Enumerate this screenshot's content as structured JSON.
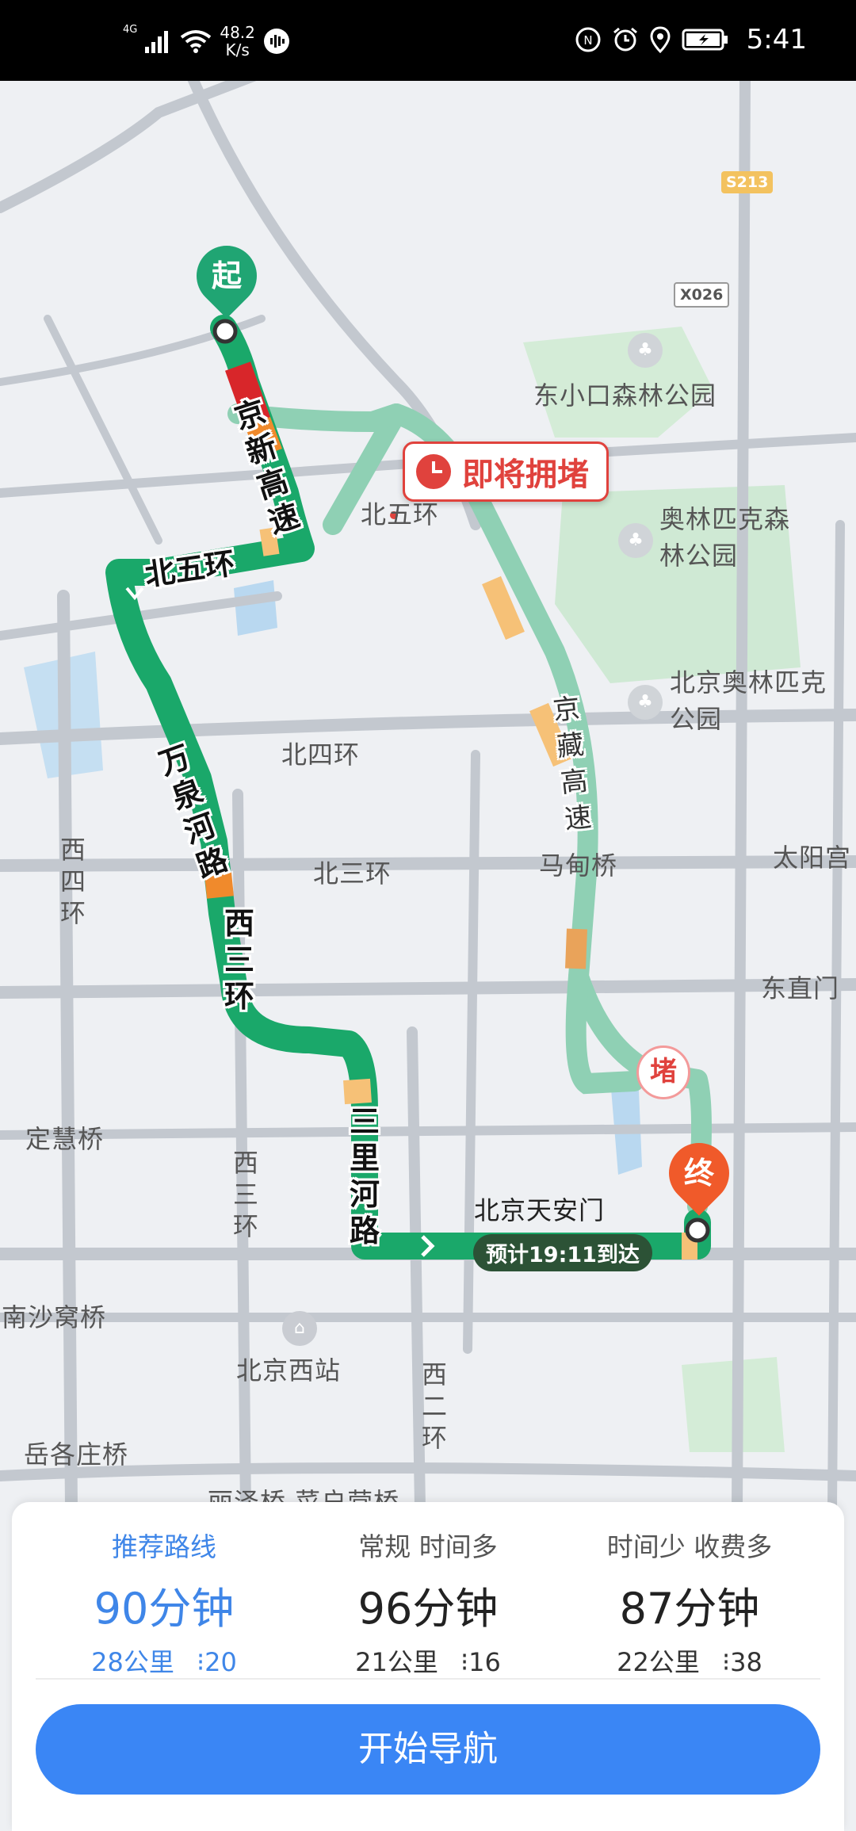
{
  "status_bar": {
    "network": "4G",
    "speed_value": "48.2",
    "speed_unit": "K/s",
    "time": "5:41"
  },
  "map": {
    "road_labels": {
      "beiwuhuan_top": "北五环",
      "beisihuan": "北四环",
      "beisanhuan": "北三环",
      "xisihuan": "西四环",
      "xisanhuan_lower": "西三环",
      "xierhuan": "西二环",
      "dinghuiqiao": "定慧桥",
      "nanshawoqiao": "南沙窝桥",
      "yuegezhuangqiao": "岳各庄桥",
      "taiyang": "太阳宫",
      "dongzhimen": "东直门",
      "madianqiao": "马甸桥",
      "bottom_partial": "丽泽桥  菜户营桥"
    },
    "route_labels": {
      "jingxin": "京新高速",
      "beiwuhuan": "北五环",
      "wanquanhe": "万泉河路",
      "xisanhuan": "西三环",
      "sanlihe": "三里河路",
      "jingzang": "京藏高速"
    },
    "badges": {
      "s213": "S213",
      "x026": "X026"
    },
    "pois": {
      "dongxiaokou": "东小口森林公园",
      "aolin1": "奥林匹克森林公园",
      "aolin2": "北京奥林匹克公园",
      "tiananmen": "北京天安门",
      "xizhan": "北京西站"
    },
    "callout": "即将拥堵",
    "start_pin": "起",
    "end_pin": "终",
    "jam_badge": "堵",
    "eta": "预计19:11到达"
  },
  "routes": [
    {
      "tag": "推荐路线",
      "time": "90分钟",
      "distance": "28公里",
      "lights": "20",
      "selected": true
    },
    {
      "tag": "常规  时间多",
      "time": "96分钟",
      "distance": "21公里",
      "lights": "16",
      "selected": false
    },
    {
      "tag": "时间少  收费多",
      "time": "87分钟",
      "distance": "22公里",
      "lights": "38",
      "selected": false
    }
  ],
  "start_button": "开始导航",
  "colors": {
    "route_main": "#1aa86a",
    "route_alt": "#8fd0b4",
    "congestion": "#e0423d",
    "accent_blue": "#3a86f5"
  }
}
